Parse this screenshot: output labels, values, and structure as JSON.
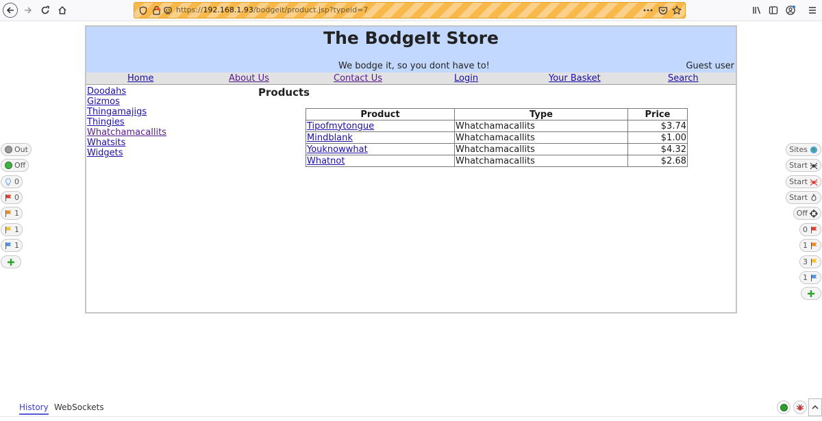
{
  "browser": {
    "url": {
      "scheme": "https://",
      "host": "192.168.1.93",
      "path": "/bodgeit/product.jsp?typeid=7"
    }
  },
  "header": {
    "title": "The BodgeIt Store",
    "tagline": "We bodge it, so you dont have to!",
    "user": "Guest user"
  },
  "nav": [
    "Home",
    "About Us",
    "Contact Us",
    "Login",
    "Your Basket",
    "Search"
  ],
  "categories": [
    "Doodahs",
    "Gizmos",
    "Thingamajigs",
    "Thingies",
    "Whatchamacallits",
    "Whatsits",
    "Widgets"
  ],
  "products": {
    "heading": "Products",
    "columns": [
      "Product",
      "Type",
      "Price"
    ],
    "rows": [
      {
        "name": "Tipofmytongue",
        "type": "Whatchamacallits",
        "price": "$3.74"
      },
      {
        "name": "Mindblank",
        "type": "Whatchamacallits",
        "price": "$1.00"
      },
      {
        "name": "Youknowwhat",
        "type": "Whatchamacallits",
        "price": "$4.32"
      },
      {
        "name": "Whatnot",
        "type": "Whatchamacallits",
        "price": "$2.68"
      }
    ]
  },
  "hud_left": [
    {
      "label": "Out",
      "icon": "gray-circle-icon"
    },
    {
      "label": "Off",
      "icon": "green-circle-icon"
    },
    {
      "label": "0",
      "icon": "lightbulb-icon"
    },
    {
      "label": "0",
      "icon": "red-flag-icon"
    },
    {
      "label": "1",
      "icon": "orange-flag-icon"
    },
    {
      "label": "1",
      "icon": "yellow-flag-icon"
    },
    {
      "label": "1",
      "icon": "blue-flag-icon"
    }
  ],
  "hud_right": [
    {
      "label": "Sites",
      "icon": "globe-icon"
    },
    {
      "label": "Start",
      "icon": "spider-icon"
    },
    {
      "label": "Start",
      "icon": "ajax-spider-icon"
    },
    {
      "label": "Start",
      "icon": "flame-icon"
    },
    {
      "label": "Off",
      "icon": "crosshair-icon"
    },
    {
      "label": "0",
      "icon": "red-flag-icon"
    },
    {
      "label": "1",
      "icon": "orange-flag-icon"
    },
    {
      "label": "3",
      "icon": "yellow-flag-icon"
    },
    {
      "label": "1",
      "icon": "blue-flag-icon"
    }
  ],
  "bottom_tabs": [
    "History",
    "WebSockets"
  ],
  "colors": {
    "header_bg": "#c3d8fe",
    "link": "#1a0dab",
    "visited_link": "#551a8b",
    "urlbar_stripe": "#f9b94a"
  }
}
